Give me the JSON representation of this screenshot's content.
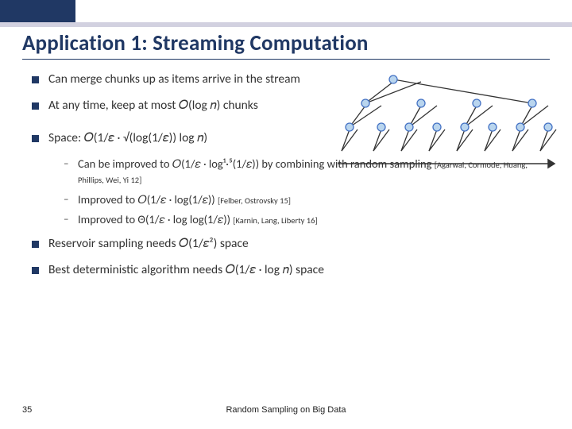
{
  "title": "Application 1: Streaming Computation",
  "bullets": {
    "b1": "Can merge chunks up as items arrive in the stream",
    "b2": "At any time, keep at most 𝑂(log 𝑛) chunks",
    "b3": "Space: 𝑂(1/𝜀 · √(log(1/𝜀)) log 𝑛)",
    "b4": "Reservoir sampling needs 𝑂(1/𝜀²) space",
    "b5": "Best deterministic algorithm needs 𝑂(1/𝜀 · log 𝑛) space"
  },
  "sub": {
    "s1a": "Can be improved to 𝑂(1/𝜀 · log¹·⁵(1/𝜀)) by combining with random sampling ",
    "s1b": "[Agarwal, Cormode, Huang, Phillips, Wei, Yi 12]",
    "s2a": "Improved to 𝑂(1/𝜀 · log(1/𝜀)) ",
    "s2b": "[Felber, Ostrovsky 15]",
    "s3a": "Improved to Θ(1/𝜀 · log log(1/𝜀)) ",
    "s3b": "[Karnin, Lang, Liberty 16]"
  },
  "footer": {
    "page": "35",
    "title": "Random Sampling on Big Data"
  },
  "colors": {
    "accent": "#203864",
    "node_fill": "#b9d5ee",
    "node_stroke": "#4472c4"
  }
}
